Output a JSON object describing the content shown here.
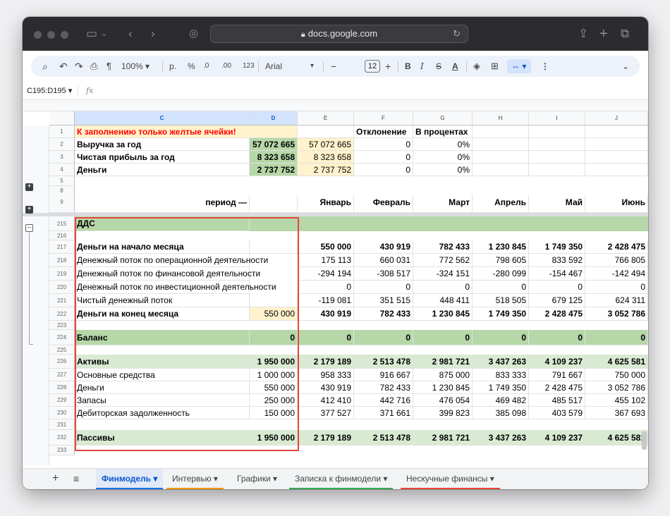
{
  "browser": {
    "url": "docs.google.com"
  },
  "toolbar": {
    "zoom": "100%",
    "format_rub": "р.",
    "percent": "%",
    "dec_less": ".0",
    "dec_more": ".00",
    "num_format": "123",
    "font": "Arial",
    "font_size": "12",
    "bold": "B",
    "italic": "I",
    "strike": "S",
    "text_color": "A"
  },
  "formula_bar": {
    "name_box": "C195:D195",
    "fx": "fx"
  },
  "columns": [
    "C",
    "D",
    "E",
    "F",
    "G",
    "H",
    "I",
    "J"
  ],
  "top_rows": {
    "r1": {
      "num": "1",
      "c": "К заполнению только желтые ячейки!",
      "f": "Отклонение",
      "g": "В процентах"
    },
    "r2": {
      "num": "2",
      "c": "Выручка за год",
      "d": "57 072 665",
      "e": "57 072 665",
      "f": "0",
      "g": "0%"
    },
    "r3": {
      "num": "3",
      "c": "Чистая прибыль за год",
      "d": "8 323 658",
      "e": "8 323 658",
      "f": "0",
      "g": "0%"
    },
    "r4": {
      "num": "4",
      "c": "Деньги",
      "d": "2 737 752",
      "e": "2 737 752",
      "f": "0",
      "g": "0%"
    },
    "r5": {
      "num": "5"
    },
    "r8": {
      "num": "8"
    },
    "r9": {
      "num": "9",
      "c": "период —",
      "e": "Январь",
      "f": "Февраль",
      "g": "Март",
      "h": "Апрель",
      "i": "Май",
      "j": "Июнь"
    }
  },
  "rows": {
    "r215": {
      "num": "215",
      "c": "ДДС"
    },
    "r216": {
      "num": "216"
    },
    "r217": {
      "num": "217",
      "c": "Деньги на начало месяца",
      "e": "550 000",
      "f": "430 919",
      "g": "782 433",
      "h": "1 230 845",
      "i": "1 749 350",
      "j": "2 428 475"
    },
    "r218": {
      "num": "218",
      "c": "Денежный поток по операционной деятельности",
      "e": "175 113",
      "f": "660 031",
      "g": "772 562",
      "h": "798 605",
      "i": "833 592",
      "j": "766 805"
    },
    "r219": {
      "num": "219",
      "c": "Денежный поток по финансовой деятельности",
      "e": "-294 194",
      "f": "-308 517",
      "g": "-324 151",
      "h": "-280 099",
      "i": "-154 467",
      "j": "-142 494"
    },
    "r220": {
      "num": "220",
      "c": "Денежный поток по инвестиционной деятельности",
      "e": "0",
      "f": "0",
      "g": "0",
      "h": "0",
      "i": "0",
      "j": "0"
    },
    "r221": {
      "num": "221",
      "c": "Чистый денежный поток",
      "e": "-119 081",
      "f": "351 515",
      "g": "448 411",
      "h": "518 505",
      "i": "679 125",
      "j": "624 311"
    },
    "r222": {
      "num": "222",
      "c": "Деньги на конец месяца",
      "d": "550 000",
      "e": "430 919",
      "f": "782 433",
      "g": "1 230 845",
      "h": "1 749 350",
      "i": "2 428 475",
      "j": "3 052 786"
    },
    "r223": {
      "num": "223"
    },
    "r224": {
      "num": "224",
      "c": "Баланс",
      "d": "0",
      "e": "0",
      "f": "0",
      "g": "0",
      "h": "0",
      "i": "0",
      "j": "0"
    },
    "r225": {
      "num": "225"
    },
    "r226": {
      "num": "226",
      "c": "Активы",
      "d": "1 950 000",
      "e": "2 179 189",
      "f": "2 513 478",
      "g": "2 981 721",
      "h": "3 437 263",
      "i": "4 109 237",
      "j": "4 625 581"
    },
    "r227": {
      "num": "227",
      "c": "Основные средства",
      "d": "1 000 000",
      "e": "958 333",
      "f": "916 667",
      "g": "875 000",
      "h": "833 333",
      "i": "791 667",
      "j": "750 000"
    },
    "r228": {
      "num": "228",
      "c": "Деньги",
      "d": "550 000",
      "e": "430 919",
      "f": "782 433",
      "g": "1 230 845",
      "h": "1 749 350",
      "i": "2 428 475",
      "j": "3 052 786"
    },
    "r229": {
      "num": "229",
      "c": "Запасы",
      "d": "250 000",
      "e": "412 410",
      "f": "442 716",
      "g": "476 054",
      "h": "469 482",
      "i": "485 517",
      "j": "455 102"
    },
    "r230": {
      "num": "230",
      "c": "Дебиторская задолженность",
      "d": "150 000",
      "e": "377 527",
      "f": "371 661",
      "g": "399 823",
      "h": "385 098",
      "i": "403 579",
      "j": "367 693"
    },
    "r231": {
      "num": "231"
    },
    "r232": {
      "num": "232",
      "c": "Пассивы",
      "d": "1 950 000",
      "e": "2 179 189",
      "f": "2 513 478",
      "g": "2 981 721",
      "h": "3 437 263",
      "i": "4 109 237",
      "j": "4 625 581"
    },
    "r233": {
      "num": "233"
    }
  },
  "sheet_tabs": [
    {
      "label": "Финмодель",
      "color": "#1a73e8"
    },
    {
      "label": "Интервью",
      "color": "#f29900"
    },
    {
      "label": "Графики",
      "color": ""
    },
    {
      "label": "Записка к финмодели",
      "color": "#34a853"
    },
    {
      "label": "Нескучные финансы",
      "color": "#ea4335"
    }
  ],
  "colors": {
    "yellow": "#fff2cc",
    "green": "#b6d7a8",
    "light_green": "#d9ead3",
    "red_text": "#ff0000",
    "highlight_box": "#e8453c"
  }
}
